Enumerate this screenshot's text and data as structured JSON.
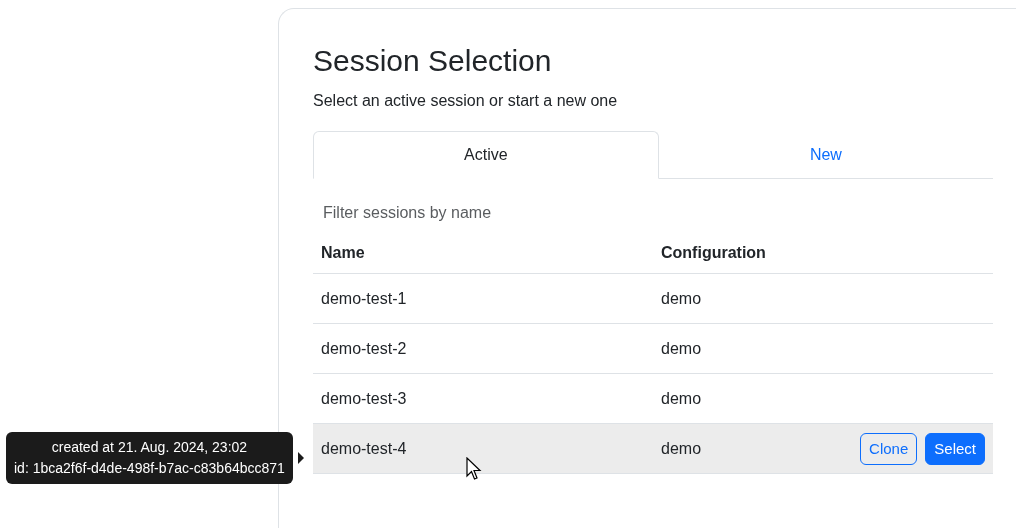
{
  "title": "Session Selection",
  "subtitle": "Select an active session or start a new one",
  "tabs": [
    {
      "label": "Active",
      "selected": true
    },
    {
      "label": "New",
      "selected": false
    }
  ],
  "filter": {
    "placeholder": "Filter sessions by name"
  },
  "table": {
    "columns": [
      "Name",
      "Configuration"
    ],
    "rows": [
      {
        "name": "demo-test-1",
        "configuration": "demo",
        "hovered": false
      },
      {
        "name": "demo-test-2",
        "configuration": "demo",
        "hovered": false
      },
      {
        "name": "demo-test-3",
        "configuration": "demo",
        "hovered": false
      },
      {
        "name": "demo-test-4",
        "configuration": "demo",
        "hovered": true,
        "actions": [
          {
            "label": "Clone",
            "kind": "outline"
          },
          {
            "label": "Select",
            "kind": "primary"
          }
        ],
        "tooltip": [
          "created at 21. Aug. 2024, 23:02",
          "id: 1bca2f6f-d4de-498f-b7ac-c83b64bcc871"
        ]
      }
    ]
  }
}
